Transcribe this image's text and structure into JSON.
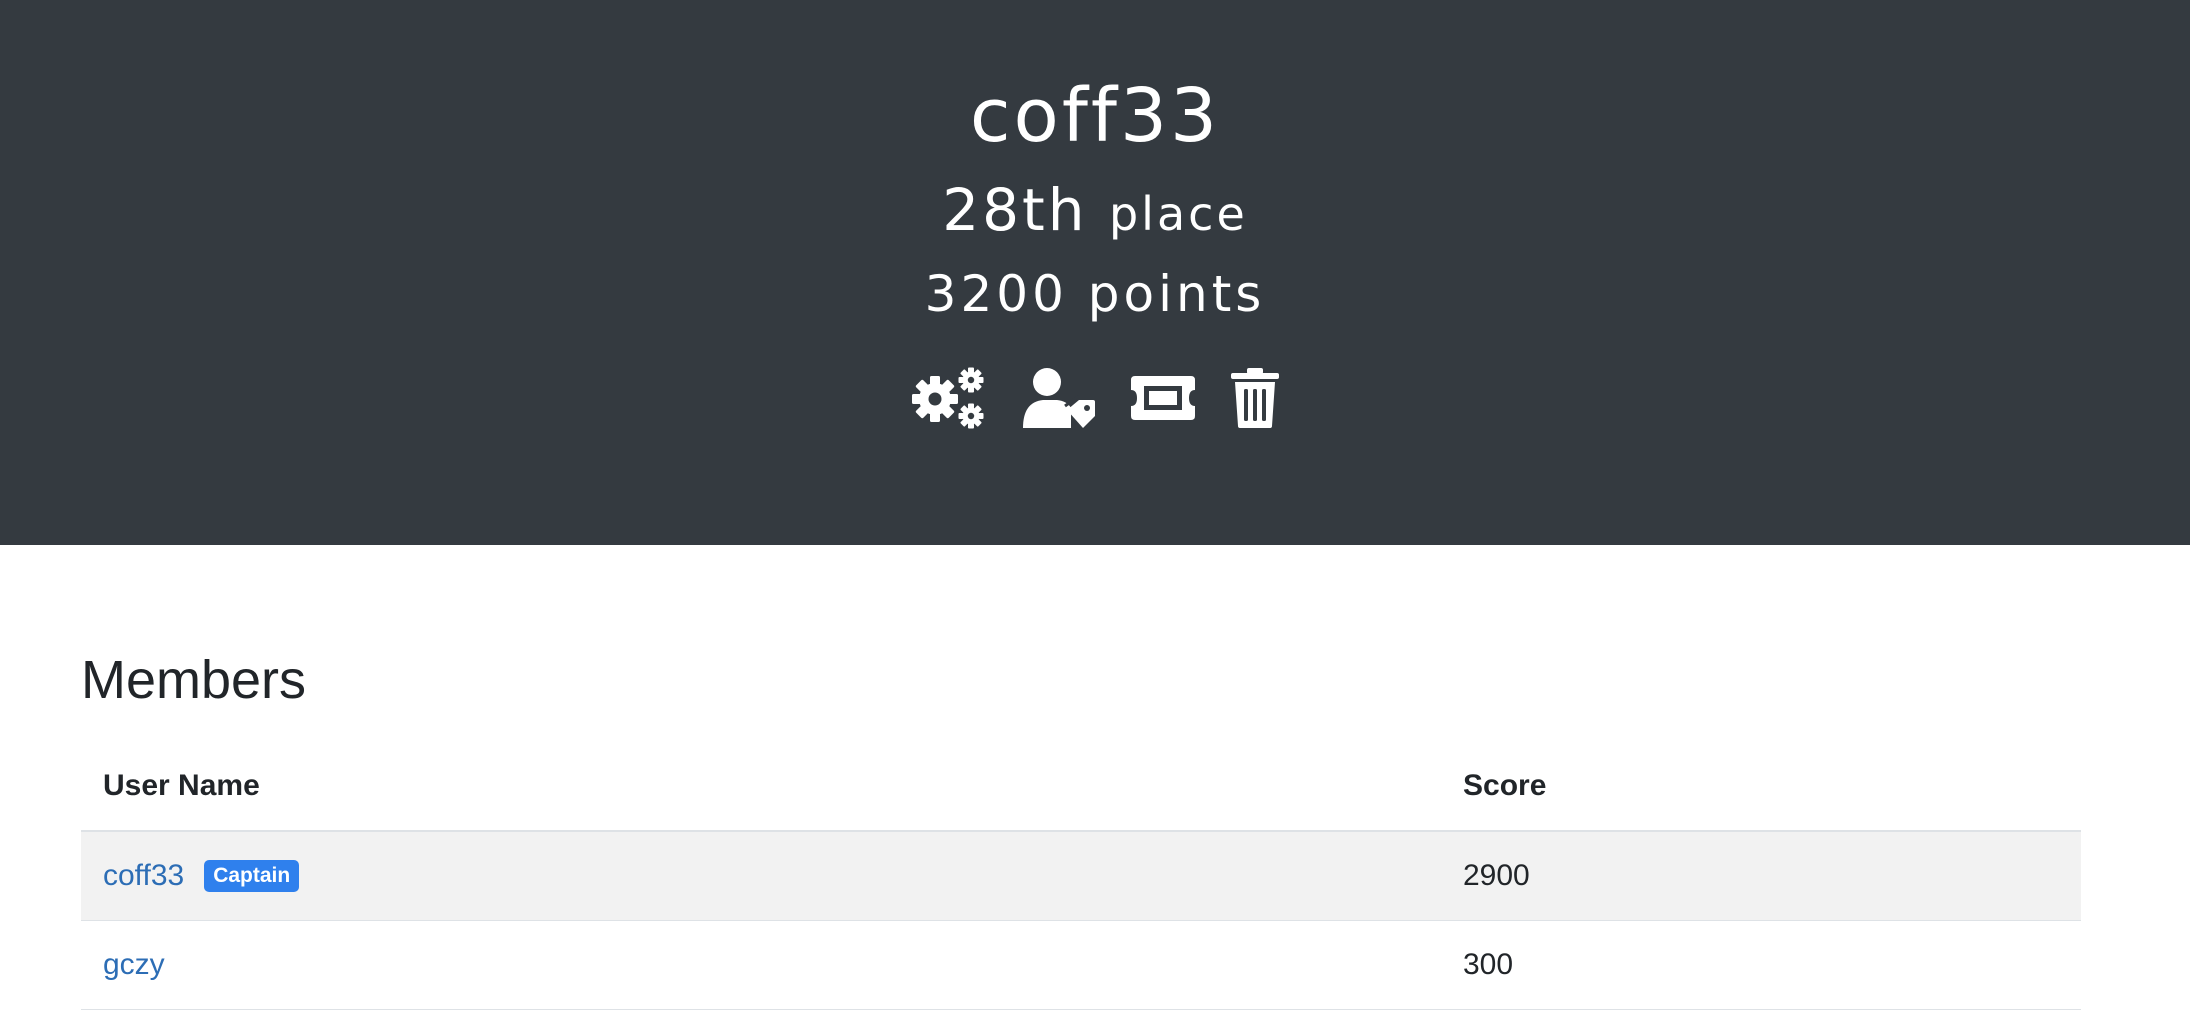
{
  "team": {
    "name": "coff33",
    "place_number": "28th",
    "place_suffix": "place",
    "points": "3200 points"
  },
  "actions": [
    {
      "icon": "cogs-icon"
    },
    {
      "icon": "user-tag-icon"
    },
    {
      "icon": "ticket-icon"
    },
    {
      "icon": "trash-icon"
    }
  ],
  "members": {
    "title": "Members",
    "columns": {
      "username": "User Name",
      "score": "Score"
    },
    "rows": [
      {
        "name": "coff33",
        "badge": "Captain",
        "score": "2900"
      },
      {
        "name": "gczy",
        "badge": "",
        "score": "300"
      }
    ]
  },
  "colors": {
    "header_bg": "#343a40",
    "link": "#2c6db5",
    "badge": "#2f80ed"
  }
}
